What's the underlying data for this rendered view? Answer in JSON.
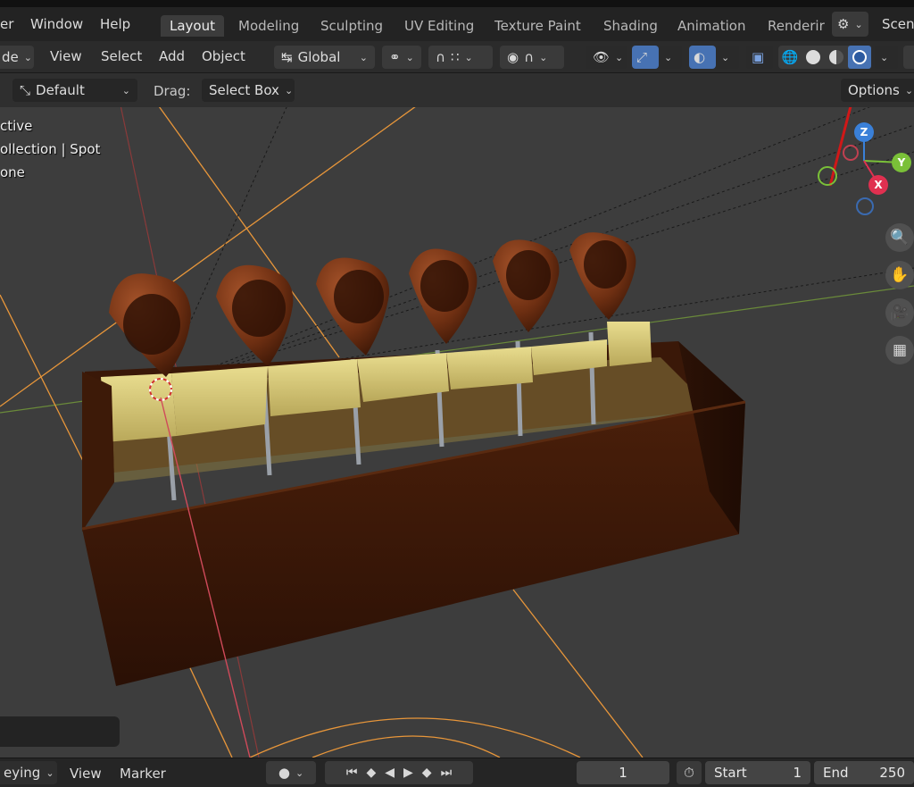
{
  "topbar": {
    "menu_partial": "er",
    "window": "Window",
    "help": "Help",
    "tabs": [
      {
        "label": "Layout",
        "active": true
      },
      {
        "label": "Modeling"
      },
      {
        "label": "Sculpting"
      },
      {
        "label": "UV Editing"
      },
      {
        "label": "Texture Paint"
      },
      {
        "label": "Shading"
      },
      {
        "label": "Animation"
      },
      {
        "label": "Renderir"
      }
    ],
    "scene_label": "Scene"
  },
  "header": {
    "mode_partial": "de",
    "view": "View",
    "select": "Select",
    "add": "Add",
    "object": "Object",
    "transform_orientation": "Global"
  },
  "toolset": {
    "orientation_default": "Default",
    "drag_label": "Drag:",
    "drag_value": "Select Box",
    "options": "Options"
  },
  "viewport": {
    "overlay_lines": [
      "ctive",
      "ollection | Spot",
      "one"
    ],
    "axes": {
      "z": "Z",
      "y": "Y",
      "x": "X"
    },
    "accent": "#4772b3",
    "annotation_color": "#d01818"
  },
  "timeline": {
    "keying_partial": "eying",
    "view": "View",
    "marker": "Marker",
    "current_frame": "1",
    "start_label": "Start",
    "start_value": "1",
    "end_label": "End",
    "end_value": "250"
  }
}
